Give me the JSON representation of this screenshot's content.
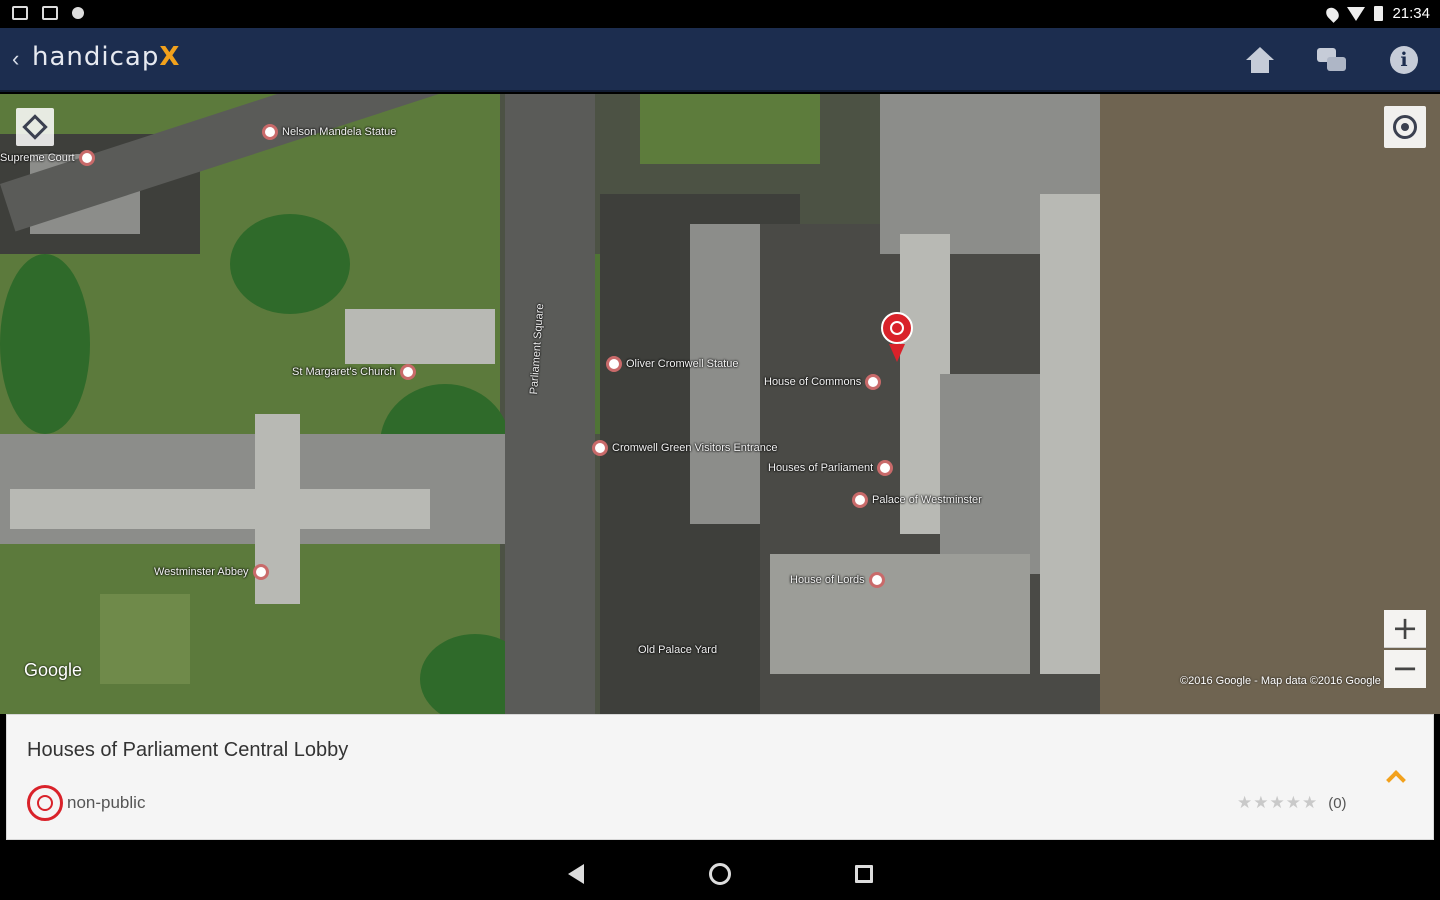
{
  "status_bar": {
    "time": "21:34"
  },
  "app_bar": {
    "back_icon": "chevron-left-icon",
    "logo_text": "handicap",
    "logo_x": "X",
    "home_icon": "home-icon",
    "chat_icon": "chat-bubbles-icon",
    "info_icon": "info-icon",
    "info_glyph": "i",
    "colors": {
      "background": "#1c2d4f",
      "accent": "#f2a11c"
    }
  },
  "map": {
    "layers_icon": "layers-icon",
    "locate_icon": "my-location-icon",
    "zoom_in": "+",
    "zoom_out": "−",
    "google_logo": "Google",
    "attribution": "©2016 Google - Map data ©2016 Google",
    "poi_labels": [
      "Nelson Mandela Statue",
      "Supreme Court",
      "St Margaret's Church",
      "Oliver Cromwell Statue",
      "Cromwell Green Visitors Entrance",
      "Westminster Abbey",
      "Houses of Parliament",
      "Palace of Westminster",
      "House of Commons",
      "House of Lords",
      "Old Palace Yard",
      "Parliament Square"
    ],
    "selected_marker_icon": "wheelchair-marker-icon"
  },
  "place_card": {
    "title": "Houses of Parliament Central Lobby",
    "access_icon": "wheelchair-restricted-icon",
    "access_label": "non-public",
    "expand_icon": "chevron-up-icon",
    "stars": "★★★★★",
    "rating_count": "(0)",
    "colors": {
      "access": "#d9222a",
      "expand": "#f2a11c"
    }
  },
  "nav_bar": {
    "back_icon": "back-triangle-icon",
    "home_icon": "home-circle-icon",
    "recents_icon": "recents-square-icon"
  }
}
